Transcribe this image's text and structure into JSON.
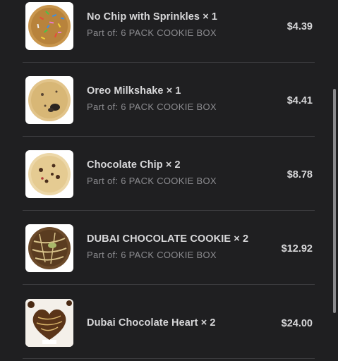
{
  "cart": {
    "items": [
      {
        "name": "No Chip with Sprinkles × 1",
        "part_of": "Part of: 6 PACK COOKIE BOX",
        "price": "$4.39",
        "image": "sprinkles-cookie"
      },
      {
        "name": "Oreo Milkshake × 1",
        "part_of": "Part of: 6 PACK COOKIE BOX",
        "price": "$4.41",
        "image": "oreo-cookie"
      },
      {
        "name": "Chocolate Chip × 2",
        "part_of": "Part of: 6 PACK COOKIE BOX",
        "price": "$8.78",
        "image": "chocolate-chip-cookie"
      },
      {
        "name": "DUBAI CHOCOLATE COOKIE × 2",
        "part_of": "Part of: 6 PACK COOKIE BOX",
        "price": "$12.92",
        "image": "dubai-chocolate-cookie"
      },
      {
        "name": "Dubai Chocolate Heart × 2",
        "part_of": "",
        "price": "$24.00",
        "image": "dubai-chocolate-heart"
      }
    ]
  },
  "colors": {
    "background": "#1f1f21",
    "text_primary": "#d7d7d9",
    "text_secondary": "#8c8c90",
    "divider": "#3a3a3d"
  }
}
